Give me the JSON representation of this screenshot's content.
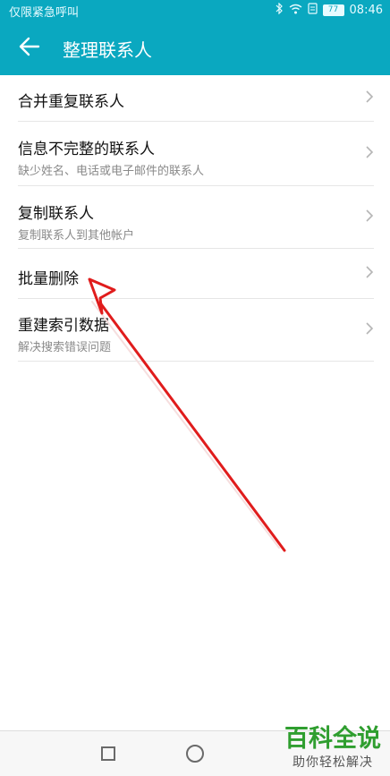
{
  "status_bar": {
    "carrier": "仅限紧急呼叫",
    "battery": "77",
    "time": "08:46",
    "icons": [
      "bluetooth-icon",
      "wifi-icon",
      "alarm-icon",
      "battery-icon"
    ]
  },
  "app_bar": {
    "title": "整理联系人",
    "back_icon": "back-arrow-icon",
    "color": "#0aa8c0"
  },
  "menu": {
    "merge": {
      "title": "合并重复联系人"
    },
    "incomplete": {
      "title": "信息不完整的联系人",
      "subtitle": "缺少姓名、电话或电子邮件的联系人"
    },
    "copy": {
      "title": "复制联系人",
      "subtitle": "复制联系人到其他帐户"
    },
    "batch_delete": {
      "title": "批量删除"
    },
    "rebuild": {
      "title": "重建索引数据",
      "subtitle": "解决搜索错误问题"
    }
  },
  "nav_bar": {
    "icons": [
      "recent-apps-icon",
      "home-icon"
    ]
  },
  "watermark": {
    "brand": "百科全说",
    "slogan": "助你轻松解决"
  },
  "annotation": {
    "color": "#e01c1c"
  }
}
